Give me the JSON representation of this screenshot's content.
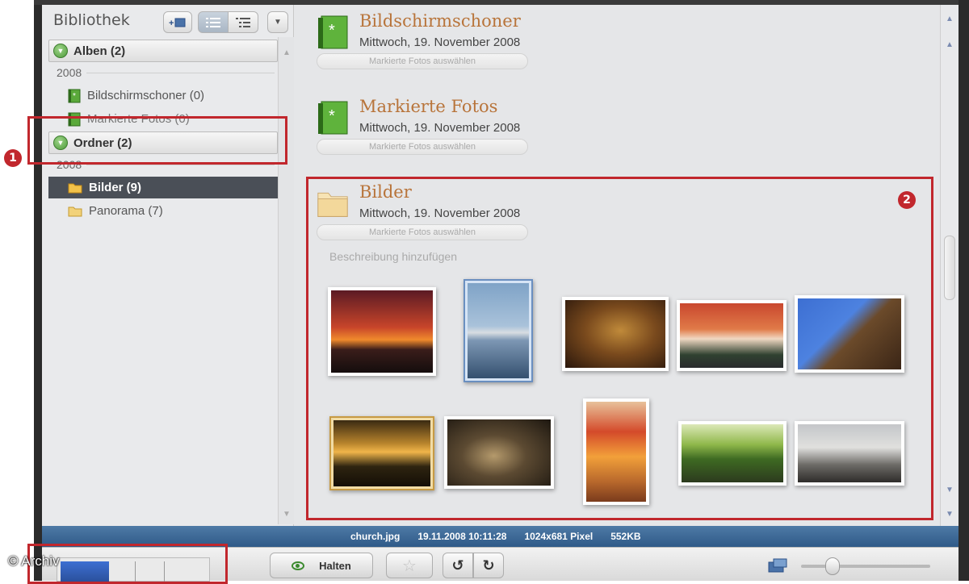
{
  "sidebar": {
    "title": "Bibliothek",
    "sections": [
      {
        "label": "Alben (2)",
        "year": "2008",
        "items": [
          "Bildschirmschoner (0)",
          "Markierte Fotos (0)"
        ]
      },
      {
        "label": "Ordner (2)",
        "year": "2008",
        "items": [
          "Bilder (9)",
          "Panorama (7)"
        ]
      }
    ],
    "selected_item": "Bilder (9)"
  },
  "albums": [
    {
      "title": "Bildschirmschoner",
      "date": "Mittwoch, 19. November 2008",
      "select_label": "Markierte Fotos auswählen"
    },
    {
      "title": "Markierte Fotos",
      "date": "Mittwoch, 19. November 2008",
      "select_label": "Markierte Fotos auswählen"
    },
    {
      "title": "Bilder",
      "date": "Mittwoch, 19. November 2008",
      "select_label": "Markierte Fotos auswählen",
      "description_placeholder": "Beschreibung hinzufügen"
    }
  ],
  "status": {
    "filename": "church.jpg",
    "datetime": "19.11.2008 10:11:28",
    "dimensions": "1024x681 Pixel",
    "size": "552KB"
  },
  "toolbar": {
    "hold_label": "Halten"
  },
  "annotations": {
    "marker_1": "1",
    "marker_2": "2"
  },
  "copyright": "© Archiv",
  "colors": {
    "accent_red": "#c1272d",
    "status_bar": "#3d6896",
    "album_title": "#b8743a",
    "selected_row": "#4a4f57"
  }
}
